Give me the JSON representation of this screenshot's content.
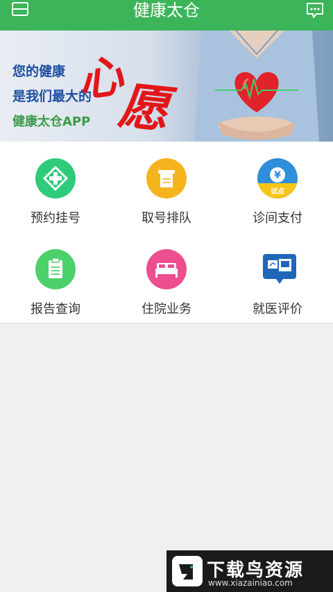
{
  "header": {
    "title": "健康太仓",
    "left_icon": "menu-icon",
    "right_icon": "chat-icon",
    "color": "#3cb55a"
  },
  "banner": {
    "line1": "您的健康",
    "line2": "是我们最大的",
    "line3": "健康太仓APP",
    "word1": "心",
    "word2": "愿"
  },
  "grid": {
    "items": [
      {
        "label": "预约挂号",
        "icon": "plus-medical-icon",
        "color": "#2ecb7a"
      },
      {
        "label": "取号排队",
        "icon": "ticket-icon",
        "color": "#f5b41e"
      },
      {
        "label": "诊间支付",
        "icon": "payment-icon",
        "color": "#2f8fd8",
        "badge": "试点"
      },
      {
        "label": "报告查询",
        "icon": "report-clipboard-icon",
        "color": "#4bd06a"
      },
      {
        "label": "住院业务",
        "icon": "bed-icon",
        "color": "#ec4e8e"
      },
      {
        "label": "就医评价",
        "icon": "monitor-evaluation-icon",
        "color": "#1f66b8"
      }
    ]
  },
  "watermark": {
    "title": "下载鸟资源",
    "url": "www.xiazainiao.com"
  }
}
